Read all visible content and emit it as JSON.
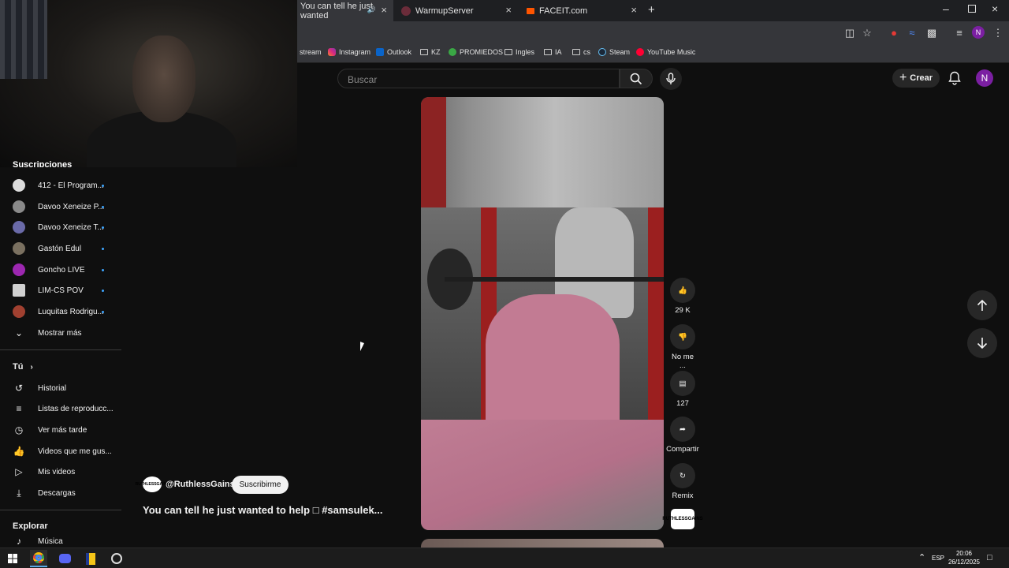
{
  "browser": {
    "tabs": [
      {
        "title": "You can tell he just wanted",
        "active": true
      },
      {
        "title": "WarmupServer",
        "active": false
      },
      {
        "title": "FACEIT.com",
        "active": false
      }
    ],
    "new_tab": "+",
    "bookmarks": [
      {
        "label": "stream",
        "icon": "twitch-icon"
      },
      {
        "label": "Instagram",
        "icon": "instagram-icon"
      },
      {
        "label": "Outlook",
        "icon": "outlook-icon"
      },
      {
        "label": "KZ",
        "icon": "folder-icon"
      },
      {
        "label": "PROMIEDOS",
        "icon": "promiedos-icon"
      },
      {
        "label": "Ingles",
        "icon": "folder-icon"
      },
      {
        "label": "IA",
        "icon": "folder-icon"
      },
      {
        "label": "cs",
        "icon": "folder-icon"
      },
      {
        "label": "Steam",
        "icon": "steam-icon"
      },
      {
        "label": "YouTube Music",
        "icon": "youtube-music-icon"
      }
    ],
    "profile_initial": "N"
  },
  "header": {
    "search_placeholder": "Buscar",
    "create_label": "Crear",
    "avatar_initial": "N"
  },
  "sidebar": {
    "subscriptions_title": "Suscripciones",
    "subscriptions": [
      {
        "label": "412 - El Program...",
        "color": "#dcdcdc"
      },
      {
        "label": "Davoo Xeneize P...",
        "color": "#8a8a8a"
      },
      {
        "label": "Davoo Xeneize T...",
        "color": "#6a6aa8"
      },
      {
        "label": "Gastón Edul",
        "color": "#7a7060"
      },
      {
        "label": "Goncho LIVE",
        "color": "#9c27b0"
      },
      {
        "label": "LIM-CS POV",
        "color": "#d0d0d0"
      },
      {
        "label": "Luquitas Rodrigu...",
        "color": "#a04030"
      }
    ],
    "show_more": "Mostrar más",
    "you_title": "Tú",
    "you_items": [
      {
        "label": "Historial",
        "icon": "history-icon"
      },
      {
        "label": "Listas de reproducc...",
        "icon": "playlist-icon"
      },
      {
        "label": "Ver más tarde",
        "icon": "clock-icon"
      },
      {
        "label": "Videos que me gus...",
        "icon": "thumb-up-icon"
      },
      {
        "label": "Mis videos",
        "icon": "video-icon"
      },
      {
        "label": "Descargas",
        "icon": "download-icon"
      }
    ],
    "explore_title": "Explorar",
    "explore_items": [
      {
        "label": "Música",
        "icon": "music-icon"
      }
    ]
  },
  "short": {
    "channel": "@RuthlessGains",
    "channel_badge": "RUTHLESSGAINS",
    "subscribe_label": "Suscribirme",
    "title": "You can tell he just wanted to help □ #samsulek...",
    "actions": {
      "like_count": "29 K",
      "dislike_label": "No me ...",
      "comments_count": "127",
      "share_label": "Compartir",
      "remix_label": "Remix"
    }
  },
  "taskbar": {
    "language": "ESP",
    "time": "20:06",
    "date": "26/12/2025"
  }
}
